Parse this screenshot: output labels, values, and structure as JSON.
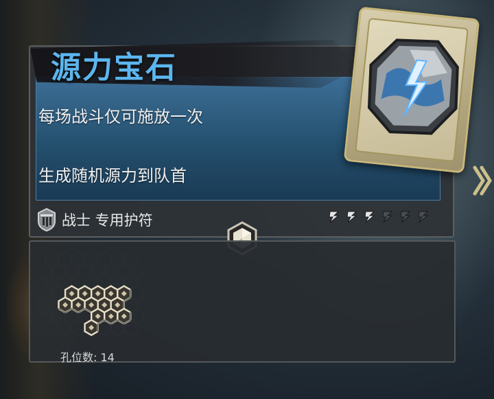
{
  "item": {
    "title": "源力宝石",
    "descriptions": [
      "每场战斗仅可施放一次",
      "生成随机源力到队首"
    ],
    "class_label": "战士 专用护符",
    "rank": {
      "filled": 3,
      "total": 6
    },
    "socket_count_label": "孔位数: 14"
  },
  "colors": {
    "title": "#5cb6ee",
    "desc_panel": "#2a5878",
    "rank_filled": "#e6e6e6",
    "rank_empty": "#4a4d50"
  },
  "icons": {
    "class": "warrior-helmet-icon",
    "rank": "lightning-rank-icon",
    "socket": "hex-socket-icon",
    "card_art": "lightning-rune-stone-icon",
    "next": "chevron-right-icon"
  }
}
